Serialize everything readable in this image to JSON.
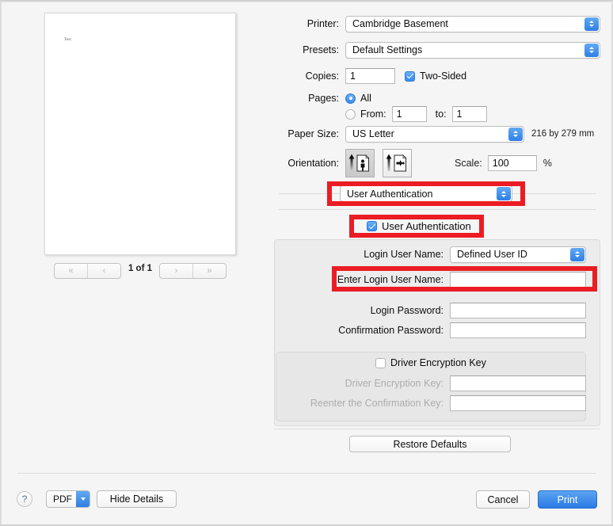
{
  "preview": {
    "document_text": "Test",
    "page_count_label": "1 of 1",
    "nav": {
      "first_label": "«",
      "prev_label": "‹",
      "next_label": "›",
      "last_label": "»"
    }
  },
  "settings": {
    "printer": {
      "label": "Printer:",
      "value": "Cambridge Basement"
    },
    "presets": {
      "label": "Presets:",
      "value": "Default Settings"
    },
    "copies": {
      "label": "Copies:",
      "value": "1"
    },
    "two_sided": {
      "label": "Two-Sided",
      "checked": true
    },
    "pages": {
      "label": "Pages:",
      "all_label": "All",
      "from_label": "From:",
      "from_value": "1",
      "to_label": "to:",
      "to_value": "1",
      "selected": "all"
    },
    "paper_size": {
      "label": "Paper Size:",
      "value": "US Letter",
      "dimensions": "216 by 279 mm"
    },
    "orientation": {
      "label": "Orientation:",
      "portrait_name": "portrait",
      "landscape_name": "landscape",
      "selected": "portrait"
    },
    "scale": {
      "label": "Scale:",
      "value": "100",
      "unit": "%"
    }
  },
  "feature_panel": {
    "selector_value": "User Authentication",
    "enable_checkbox": {
      "label": "User Authentication",
      "checked": true
    },
    "login_user_name": {
      "label": "Login User Name:",
      "value": "Defined User ID"
    },
    "enter_login_user_name": {
      "label": "Enter Login User Name:",
      "value": "",
      "placeholder": ""
    },
    "login_password": {
      "label": "Login Password:",
      "value": "",
      "placeholder": ""
    },
    "confirmation_password": {
      "label": "Confirmation Password:",
      "value": "",
      "placeholder": ""
    },
    "encryption": {
      "checkbox": {
        "label": "Driver Encryption Key",
        "checked": false
      },
      "key": {
        "label": "Driver Encryption Key:",
        "value": "",
        "placeholder": ""
      },
      "reenter": {
        "label": "Reenter the Confirmation Key:",
        "value": "",
        "placeholder": ""
      }
    },
    "restore_defaults_label": "Restore Defaults"
  },
  "footer": {
    "help_label": "?",
    "pdf_label": "PDF",
    "hide_details_label": "Hide Details",
    "cancel_label": "Cancel",
    "print_label": "Print"
  },
  "annotations": {
    "highlight_color": "#ec1c24",
    "highlighted": [
      "User Authentication selector",
      "User Authentication checkbox",
      "Enter Login User Name field"
    ]
  }
}
